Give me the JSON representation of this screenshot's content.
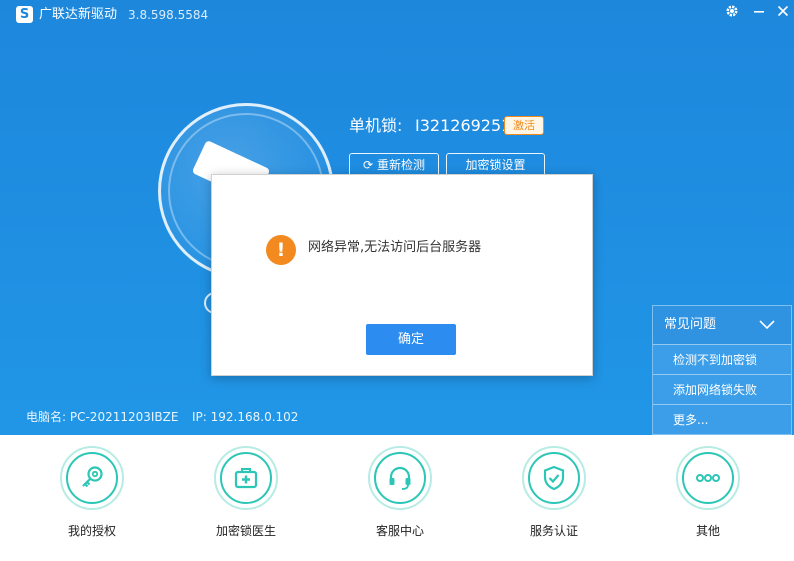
{
  "titlebar": {
    "app_name": "广联达新驱动",
    "version": "3.8.598.5584",
    "logo_icon": "glodon-logo-icon",
    "settings_icon": "gear-icon",
    "minimize_icon": "minimize-icon",
    "close_icon": "close-icon"
  },
  "lock": {
    "label": "单机锁:",
    "id": "I321269251",
    "activate_label": "激活",
    "recheck_label": "重新检测",
    "lock_settings_label": "加密锁设置"
  },
  "status": {
    "pc_name": "电脑名:  PC-20211203IBZE",
    "ip": "IP:  192.168.0.102"
  },
  "faq": {
    "title": "常见问题",
    "items": [
      {
        "label": "检测不到加密锁"
      },
      {
        "label": "添加网络锁失败"
      },
      {
        "label": "更多..."
      }
    ]
  },
  "features": [
    {
      "label": "我的授权",
      "icon": "key-icon"
    },
    {
      "label": "加密锁医生",
      "icon": "medical-kit-icon"
    },
    {
      "label": "客服中心",
      "icon": "headset-icon"
    },
    {
      "label": "服务认证",
      "icon": "shield-check-icon"
    },
    {
      "label": "其他",
      "icon": "more-dots-icon"
    }
  ],
  "dialog": {
    "message": "网络异常,无法访问后台服务器",
    "ok_label": "确定",
    "icon": "warning-icon"
  },
  "colors": {
    "primary_blue": "#1f8fe2",
    "accent_teal": "#2cc6b6",
    "warning_orange": "#f38a1f",
    "button_blue": "#2d8cf0"
  }
}
